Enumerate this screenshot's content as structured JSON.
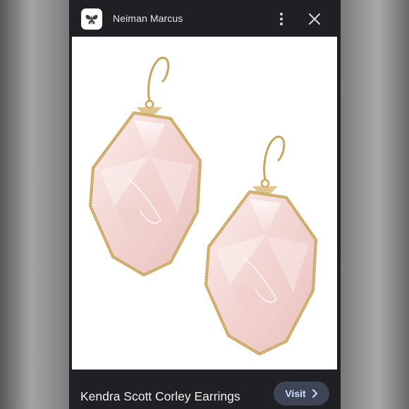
{
  "header": {
    "source_name": "Neiman Marcus",
    "logo_icon": "butterfly-icon",
    "menu_icon": "more-vert-icon",
    "close_icon": "close-icon"
  },
  "image": {
    "subject": "pair of rose quartz earrings"
  },
  "footer": {
    "product_title": "Kendra Scott Corley Earrings",
    "visit_label": "Visit",
    "visit_icon": "chevron-right-icon"
  },
  "colors": {
    "panel_bg": "#1f2023",
    "visit_bg": "#3c4456",
    "visit_text": "#cfe0ff",
    "stone": "#f4d9d5",
    "gold": "#c9a45c"
  }
}
